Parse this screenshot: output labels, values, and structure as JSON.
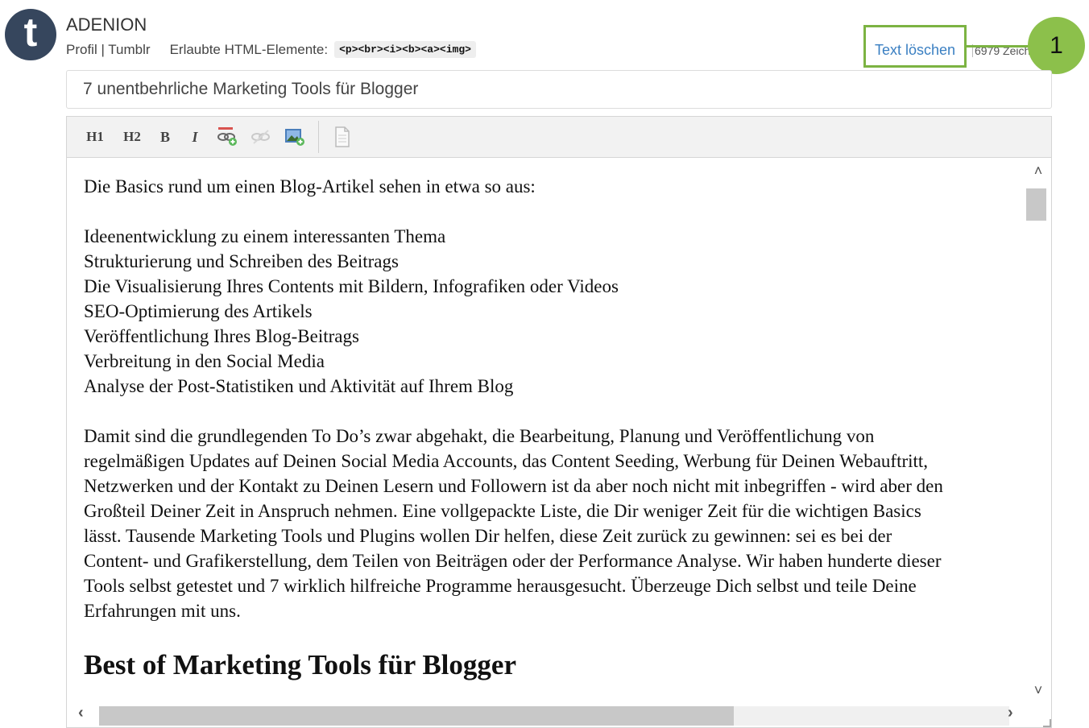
{
  "account": {
    "avatar_letter": "t",
    "name": "ADENION",
    "profile_link": "Profil | Tumblr",
    "allowed_html_label": "Erlaubte HTML-Elemente:",
    "allowed_html_tags": "<p><br><i><b><a><img>"
  },
  "header_actions": {
    "clear_text": "Text löschen",
    "char_count": "6979 Zeichen",
    "callout_number": "1"
  },
  "colors": {
    "brand": "#36465d",
    "callout_green": "#8cc04b",
    "highlight_border": "#7cb342",
    "link_blue": "#3a7fc2"
  },
  "title_field": {
    "value": "7 unentbehrliche Marketing Tools für Blogger"
  },
  "toolbar": {
    "h1_label": "H1",
    "h2_label": "H2",
    "bold_label": "B",
    "italic_label": "I",
    "icons": [
      "insert-link-icon",
      "remove-link-icon",
      "insert-image-icon",
      "source-document-icon"
    ]
  },
  "content": {
    "intro": "Die Basics rund um einen Blog-Artikel sehen in etwa so aus:",
    "list": [
      "Ideenentwicklung zu einem interessanten Thema",
      "Strukturierung und Schreiben des Beitrags",
      "Die Visualisierung Ihres Contents mit Bildern, Infografiken oder Videos",
      "SEO-Optimierung des Artikels",
      "Veröffentlichung Ihres Blog-Beitrags",
      "Verbreitung in den Social Media",
      "Analyse der Post-Statistiken und Aktivität auf Ihrem Blog"
    ],
    "paragraph_lines": [
      "Damit sind die grundlegenden To Do’s zwar abgehakt, die Bearbeitung, Planung und Veröffentlichung von",
      "regelmäßigen Updates auf Deinen Social Media Accounts, das Content Seeding, Werbung für Deinen Webauftritt,",
      "Netzwerken und der Kontakt zu Deinen Lesern und Followern ist da aber noch nicht mit inbegriffen - wird aber den",
      "Großteil Deiner Zeit in Anspruch nehmen. Eine vollgepackte Liste, die Dir weniger Zeit für die wichtigen Basics",
      "lässt. Tausende Marketing Tools und Plugins wollen Dir helfen, diese Zeit zurück zu gewinnen: sei es bei der",
      "Content- und Grafikerstellung, dem Teilen von Beiträgen oder der Performance Analyse. Wir haben hunderte dieser",
      "Tools selbst getestet und 7 wirklich hilfreiche Programme herausgesucht. Überzeuge Dich selbst und teile Deine",
      "Erfahrungen mit uns."
    ],
    "heading": "Best of Marketing Tools für Blogger"
  }
}
